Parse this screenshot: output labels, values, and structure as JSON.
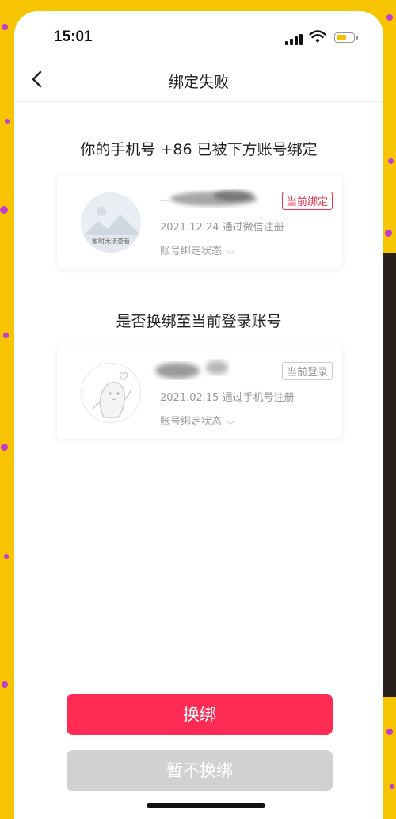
{
  "status_bar": {
    "time": "15:01"
  },
  "nav": {
    "title": "绑定失败"
  },
  "bound_section": {
    "title": "你的手机号 +86  已被下方账号绑定"
  },
  "current_bound_account": {
    "name_partial": "一",
    "tag": "当前绑定",
    "avatar_caption": "暂时无法查看",
    "registration": "2021.12.24 通过微信注册",
    "bind_status_label": "账号绑定状态"
  },
  "switch_section": {
    "title": "是否换绑至当前登录账号"
  },
  "current_login_account": {
    "tag": "当前登录",
    "registration": "2021.02.15 通过手机号注册",
    "bind_status_label": "账号绑定状态"
  },
  "actions": {
    "primary": "换绑",
    "secondary": "暂不换绑"
  },
  "colors": {
    "accent": "#fe2c55",
    "tag_red": "#e8364c",
    "secondary_button": "#d1d1d1",
    "background": "#f6c400"
  }
}
